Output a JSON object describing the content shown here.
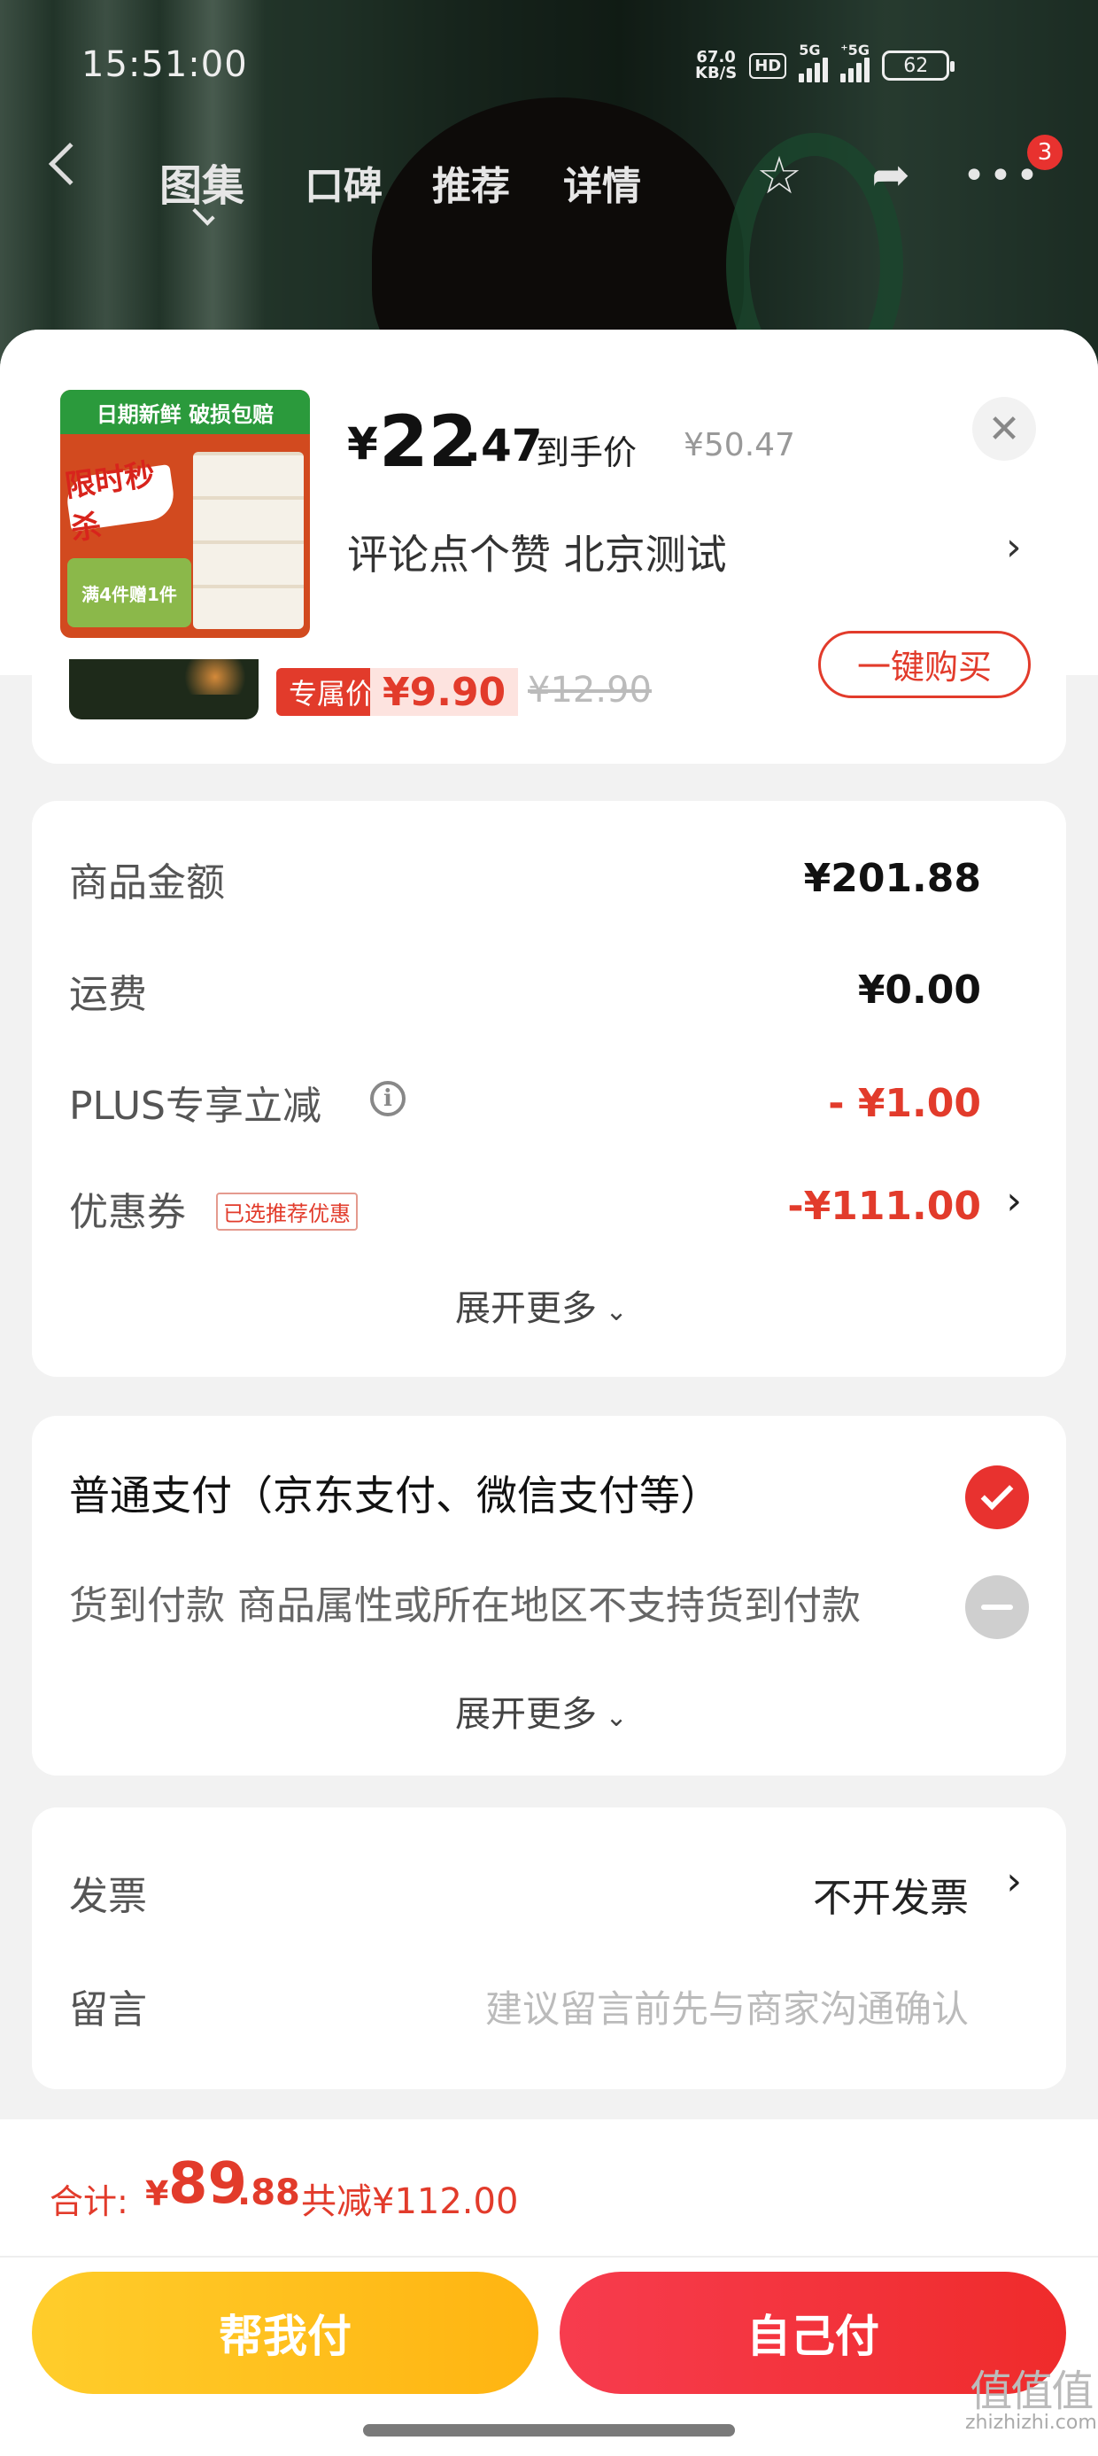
{
  "status_bar": {
    "time": "15:51:00",
    "net_speed_value": "67.0",
    "net_speed_unit": "KB/S",
    "hd": "HD",
    "sim1": "5G",
    "sim2": "⁺5G",
    "battery": "62"
  },
  "nav": {
    "tabs": [
      "图集",
      "口碑",
      "推荐",
      "详情"
    ],
    "active_tab": "图集",
    "cart_badge": "3"
  },
  "product": {
    "thumb_banner": "日期新鲜 破损包赔",
    "thumb_flash": "限时秒杀",
    "thumb_promo": "满4件赠1件",
    "price_symbol": "¥",
    "price_int": "22",
    "price_dec": ".47",
    "price_label": "到手价",
    "original_price": "¥50.47",
    "spec": "评论点个赞  北京测试"
  },
  "peek_item": {
    "tag": "专属价",
    "price": "¥9.90",
    "original": "¥12.90",
    "button": "一键购买"
  },
  "summary": {
    "goods_amount_label": "商品金额",
    "goods_amount_value": "¥201.88",
    "shipping_label": "运费",
    "shipping_value": "¥0.00",
    "plus_label": "PLUS专享立减",
    "plus_value": "- ¥1.00",
    "coupon_label": "优惠券",
    "coupon_tag": "已选推荐优惠",
    "coupon_value": "-¥111.00",
    "expand": "展开更多"
  },
  "payment": {
    "normal": "普通支付（京东支付、微信支付等）",
    "cod": "货到付款 商品属性或所在地区不支持货到付款",
    "expand": "展开更多"
  },
  "extra": {
    "invoice_label": "发票",
    "invoice_value": "不开发票",
    "message_label": "留言",
    "message_placeholder": "建议留言前先与商家沟通确认"
  },
  "total": {
    "label": "合计:",
    "symbol": "¥",
    "int": "89",
    "dec": ".88",
    "saved": "共减¥112.00"
  },
  "buttons": {
    "help_pay": "帮我付",
    "self_pay": "自己付"
  },
  "watermark": {
    "glyphs": "值值值",
    "site": "zhizhizhi.com"
  },
  "colors": {
    "accent_red": "#e23b2b",
    "yellow_button": "#ffc21e",
    "red_button": "#f3334a"
  }
}
